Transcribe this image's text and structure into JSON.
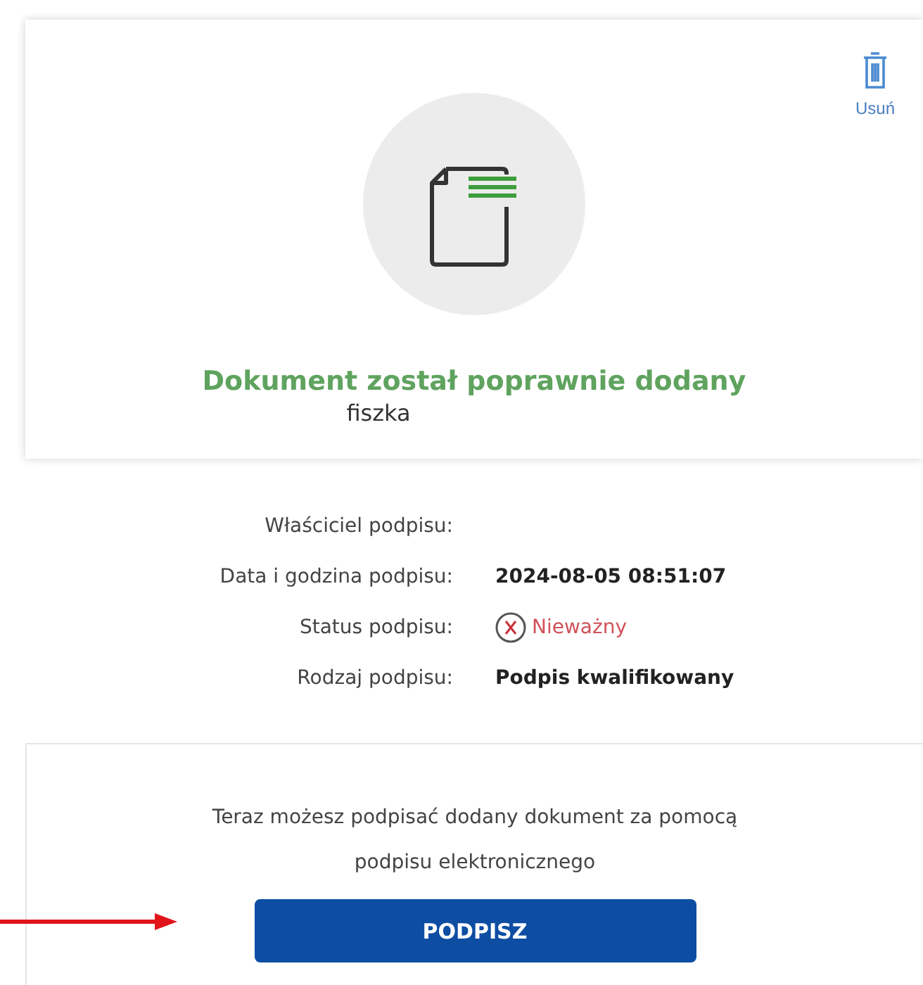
{
  "upload_card": {
    "delete_label": "Usuń",
    "message": "Dokument został poprawnie dodany",
    "file_name": "fiszka"
  },
  "signature_details": [
    {
      "label": "Właściciel podpisu:",
      "kind": "text"
    },
    {
      "label": "Data i godzina podpisu:",
      "kind": "text",
      "value": "2024-08-05 08:51:07"
    },
    {
      "label": "Status podpisu:",
      "kind": "status",
      "value": "Nieważny",
      "valid": false
    },
    {
      "label": "Rodzaj podpisu:",
      "kind": "text",
      "value": "Podpis kwalifikowany"
    }
  ],
  "sign_card": {
    "message": "Teraz możesz podpisać dodany dokument za pomocą podpisu elektronicznego",
    "button": "PODPISZ"
  }
}
